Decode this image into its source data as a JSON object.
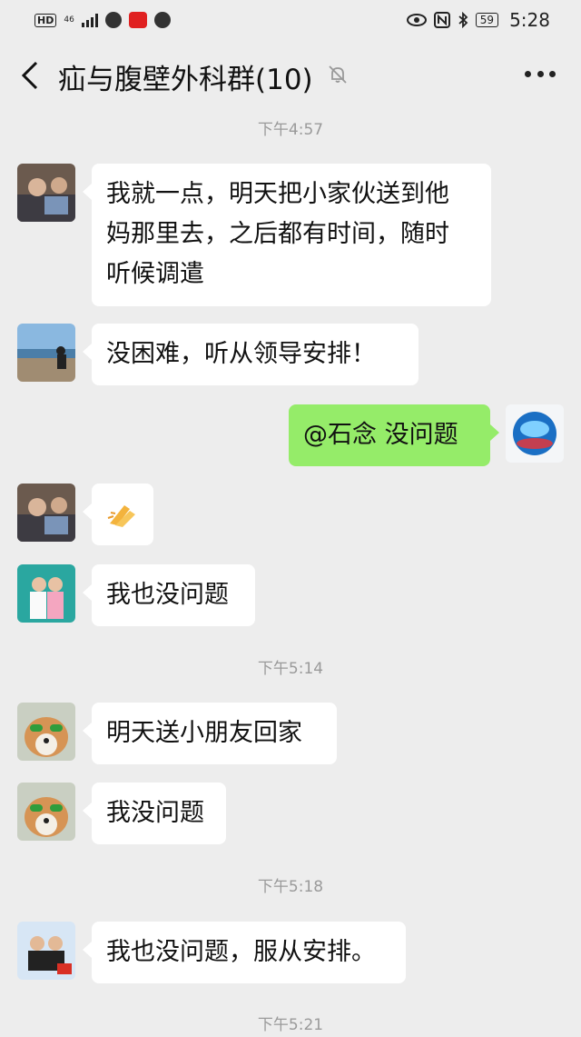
{
  "status_bar": {
    "hd": "HD",
    "network": "46",
    "battery": "59",
    "time": "5:28"
  },
  "header": {
    "title": "疝与腹壁外科群(10)",
    "back_icon": "chevron-left-icon",
    "mute_icon": "bell-off-icon",
    "more_icon": "more-dots-icon"
  },
  "messages": {
    "t1": "下午4:57",
    "m1_lines": [
      "我就一点，明天把小家伙送到他",
      "妈那里去，之后都有时间，随时",
      "听候调遣"
    ],
    "m2": "没困难，听从领导安排！",
    "m3": "@石念  没问题",
    "m4_emoji": "clapping-hands-emoji",
    "m5": "我也没问题",
    "t2": "下午5:14",
    "m6": "明天送小朋友回家",
    "m7": "我没问题",
    "t3": "下午5:18",
    "m8": "我也没问题，服从安排。",
    "t4": "下午5:21"
  },
  "colors": {
    "background": "#ededed",
    "bubble_incoming": "#ffffff",
    "bubble_outgoing": "#95ec69",
    "timestamp": "#9a9a9a"
  }
}
